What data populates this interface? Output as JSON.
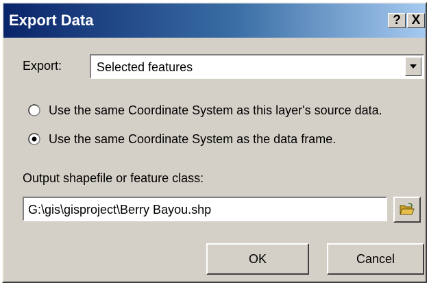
{
  "dialog": {
    "title": "Export Data",
    "help_label": "?",
    "close_label": "X"
  },
  "export": {
    "label": "Export:",
    "selected_value": "Selected features"
  },
  "coordinate_options": [
    {
      "label": "Use the same Coordinate System as this layer's source data.",
      "checked": false
    },
    {
      "label": "Use the same Coordinate System as the data frame.",
      "checked": true
    }
  ],
  "output": {
    "label": "Output shapefile or feature class:",
    "value": "G:\\gis\\gisproject\\Berry Bayou.shp"
  },
  "buttons": {
    "ok_label": "OK",
    "cancel_label": "Cancel"
  },
  "icons": {
    "browse": "open-folder-icon",
    "dropdown": "chevron-down-icon",
    "radio_unchecked": "radio-unchecked-icon",
    "radio_checked": "radio-checked-icon"
  },
  "colors": {
    "title_bar_start": "#0a246a",
    "title_bar_end": "#a6caf0",
    "dialog_face": "#d4d0c8",
    "folder_yellow": "#e8c04a"
  }
}
